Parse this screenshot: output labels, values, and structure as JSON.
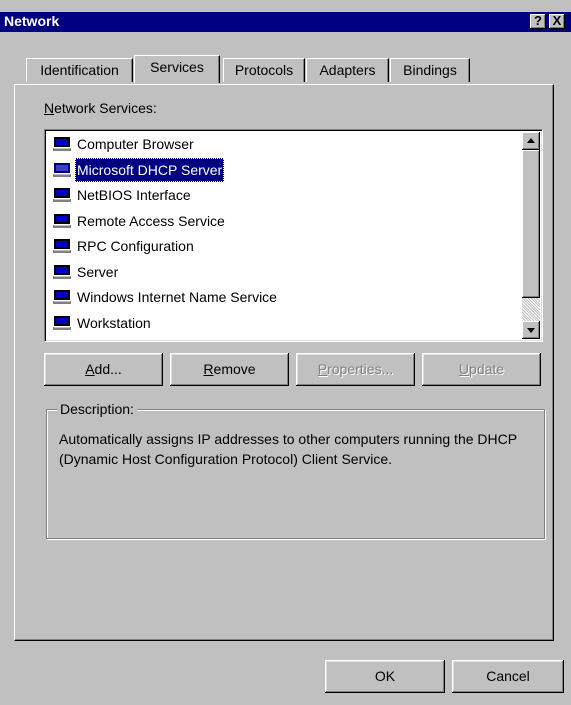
{
  "window": {
    "title": "Network",
    "help_glyph": "?",
    "close_glyph": "X"
  },
  "tabs": [
    {
      "label": "Identification"
    },
    {
      "label": "Services"
    },
    {
      "label": "Protocols"
    },
    {
      "label": "Adapters"
    },
    {
      "label": "Bindings"
    }
  ],
  "services": {
    "label_accel": "N",
    "label_rest": "etwork Services:",
    "items": [
      {
        "label": "Computer Browser"
      },
      {
        "label": "Microsoft DHCP Server"
      },
      {
        "label": "NetBIOS Interface"
      },
      {
        "label": "Remote Access Service"
      },
      {
        "label": "RPC Configuration"
      },
      {
        "label": "Server"
      },
      {
        "label": "Windows Internet Name Service"
      },
      {
        "label": "Workstation"
      }
    ],
    "selected_index": 1,
    "item_icon": "network-service-icon"
  },
  "buttons": {
    "add_accel": "A",
    "add_rest": "dd...",
    "remove_accel": "R",
    "remove_rest": "emove",
    "properties_accel": "P",
    "properties_rest": "roperties...",
    "update_accel": "U",
    "update_rest": "pdate",
    "ok": "OK",
    "cancel": "Cancel"
  },
  "description": {
    "title": "Description:",
    "text": "Automatically assigns IP addresses to other computers running the DHCP (Dynamic Host Configuration Protocol) Client Service."
  },
  "colors": {
    "face": "#c0c0c0",
    "titlebar": "#000080",
    "selection": "#000080"
  }
}
